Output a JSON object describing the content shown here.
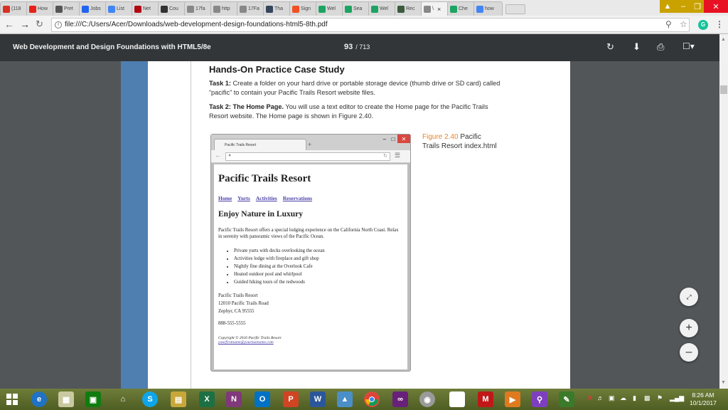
{
  "browser": {
    "tabs": [
      {
        "label": "(118",
        "icon": "gmail-icon",
        "color": "#d93025"
      },
      {
        "label": "How",
        "icon": "youtube-icon",
        "color": "#e62117"
      },
      {
        "label": "Pret",
        "icon": "w-icon",
        "color": "#555555"
      },
      {
        "label": "Jobs",
        "icon": "indeed-icon",
        "color": "#2164f3"
      },
      {
        "label": "List",
        "icon": "google-icon",
        "color": "#4285f4"
      },
      {
        "label": "Net",
        "icon": "netflix-icon",
        "color": "#b20710"
      },
      {
        "label": "Cou",
        "icon": "bb-icon",
        "color": "#333333"
      },
      {
        "label": "17fa",
        "icon": "doc-icon",
        "color": "#888888"
      },
      {
        "label": "http",
        "icon": "doc-icon",
        "color": "#888888"
      },
      {
        "label": "17Fa",
        "icon": "doc-icon",
        "color": "#888888"
      },
      {
        "label": "Tha",
        "icon": "tumblr-icon",
        "color": "#35465c"
      },
      {
        "label": "Sign",
        "icon": "windows-icon",
        "color": "#f25022"
      },
      {
        "label": "Wel",
        "icon": "chrome-c-icon",
        "color": "#1da462"
      },
      {
        "label": "Sea",
        "icon": "chrome-c-icon",
        "color": "#1da462"
      },
      {
        "label": "Wel",
        "icon": "chrome-c-icon",
        "color": "#1da462"
      },
      {
        "label": "Rec",
        "icon": "b-icon",
        "color": "#3d5a3d"
      },
      {
        "label": "\\",
        "icon": "doc-icon",
        "color": "#888888",
        "active": true
      },
      {
        "label": "Che",
        "icon": "chrome-c-icon",
        "color": "#1da462"
      },
      {
        "label": "how",
        "icon": "google-icon",
        "color": "#4285f4"
      }
    ],
    "url": "file:///C:/Users/Acer/Downloads/web-development-design-foundations-html5-8th.pdf"
  },
  "pdf": {
    "title": "Web Development and Design Foundations with HTML5/8e",
    "page": "93",
    "total": "/ 713"
  },
  "content": {
    "heading": "Hands-On Practice Case Study",
    "task1_label": "Task 1:",
    "task1_text": "Create a folder on your hard drive or portable storage device (thumb drive or SD card) called “pacific” to contain your Pacific Trails Resort website files.",
    "task2_label": "Task 2: The Home Page.",
    "task2_text": "You will use a text editor to create the Home page for the Pacific Trails Resort website. The Home page is shown in Figure 2.40.",
    "figure_number": "Figure 2.40",
    "figure_caption_1": "Pacific",
    "figure_caption_2": "Trails Resort index.html"
  },
  "mini_browser": {
    "tab_label": "Pacific Trails Resort",
    "site_title": "Pacific Trails Resort",
    "nav": [
      "Home",
      "Yurts",
      "Activities",
      "Reservations"
    ],
    "subtitle": "Enjoy Nature in Luxury",
    "intro": "Pacific Trails Resort offers a special lodging experience on the California North Coast. Relax in serenity with panoramic views of the Pacific Ocean.",
    "features": [
      "Private yurts with decks overlooking the ocean",
      "Activities lodge with fireplace and gift shop",
      "Nightly fine dining at the Overlook Cafe",
      "Heated outdoor pool and whirlpool",
      "Guided hiking tours of the redwoods"
    ],
    "address": [
      "Pacific Trails Resort",
      "12010 Pacific Trails Road",
      "Zephyr, CA 95555"
    ],
    "phone": "888-555-5555",
    "copyright": "Copyright © 2016 Pacific Trails Resort",
    "email": "yourfirstname@yourlastname.com"
  },
  "taskbar": {
    "time": "8:26 AM",
    "date": "10/1/2017"
  }
}
